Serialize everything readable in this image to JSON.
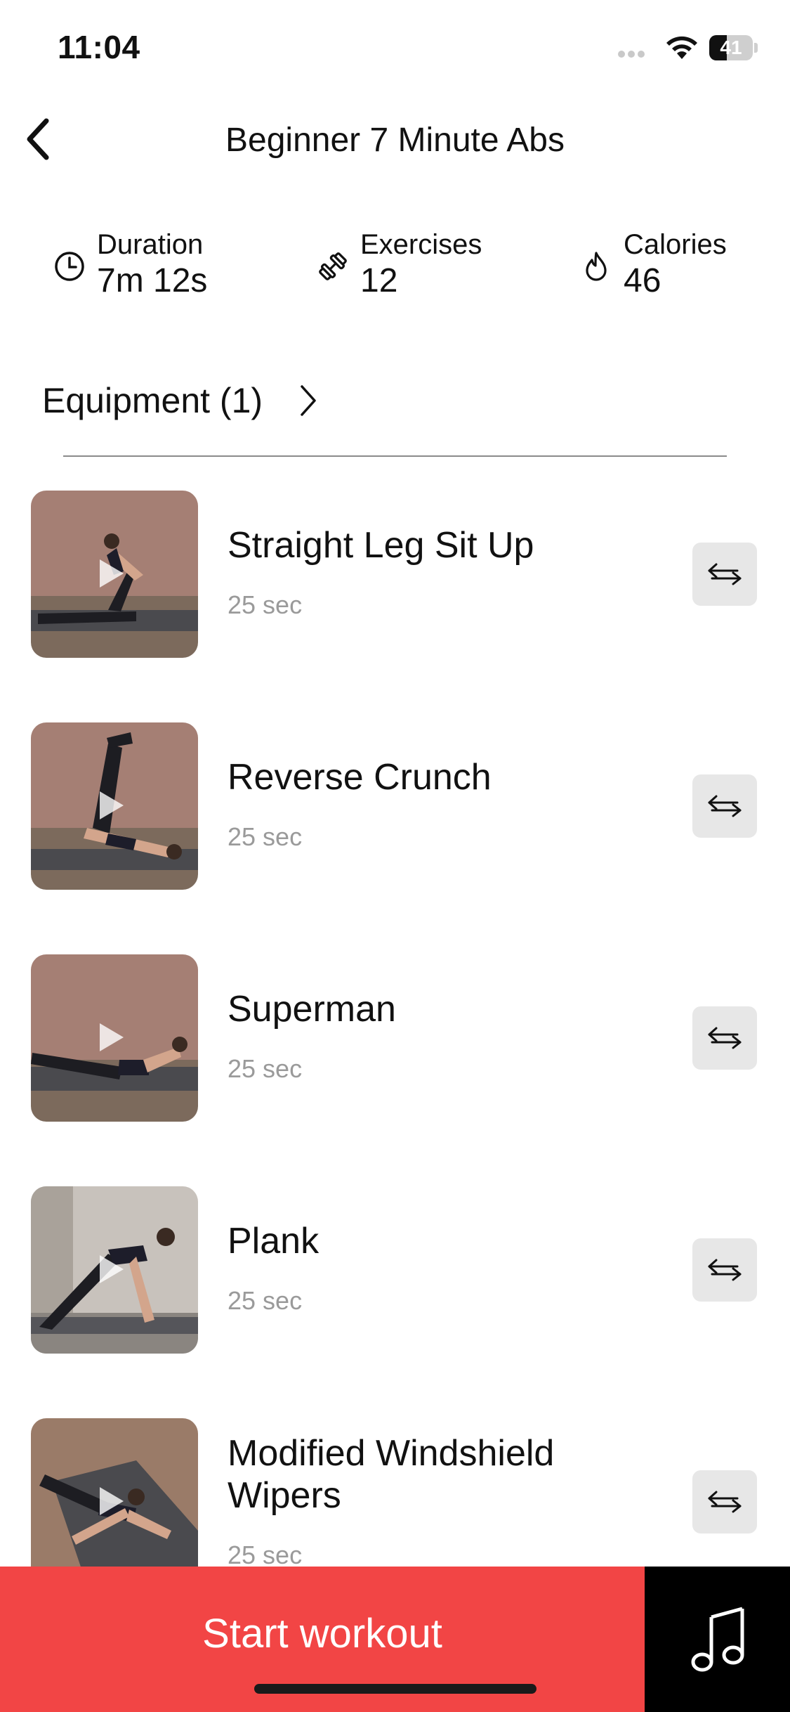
{
  "status_bar": {
    "time": "11:04",
    "battery": "41",
    "battery_level": 0.41
  },
  "nav": {
    "title": "Beginner 7 Minute Abs",
    "back_icon": "chevron-left-icon"
  },
  "stats": [
    {
      "label": "Duration",
      "value": "7m 12s",
      "icon": "clock-icon"
    },
    {
      "label": "Exercises",
      "value": "12",
      "icon": "dumbbell-icon"
    },
    {
      "label": "Calories",
      "value": "46",
      "icon": "flame-icon"
    }
  ],
  "equipment": {
    "label": "Equipment (1)",
    "icon": "chevron-right-icon"
  },
  "exercises": [
    {
      "name": "Straight Leg Sit Up",
      "duration": "25 sec"
    },
    {
      "name": "Reverse Crunch",
      "duration": "25 sec"
    },
    {
      "name": "Superman",
      "duration": "25 sec"
    },
    {
      "name": "Plank",
      "duration": "25 sec"
    },
    {
      "name": "Modified Windshield Wipers",
      "duration": "25 sec"
    }
  ],
  "bottom_bar": {
    "start_label": "Start workout",
    "music_icon": "music-note-icon"
  },
  "colors": {
    "accent": "#f24545",
    "swap_bg": "#e7e7e7",
    "duration_text": "#9a9a9a"
  }
}
